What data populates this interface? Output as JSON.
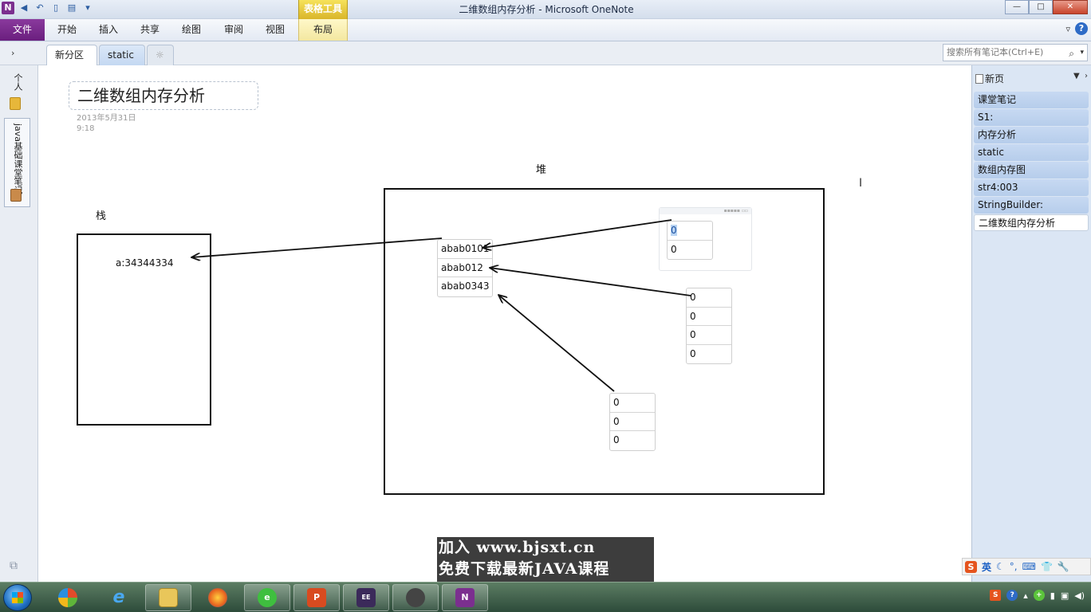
{
  "app": {
    "window_title": "二维数组内存分析 - Microsoft OneNote",
    "contextual_group": "表格工具",
    "win_buttons": {
      "minimize": "—",
      "maximize": "□",
      "close": "✕"
    }
  },
  "ribbon": {
    "file": "文件",
    "tabs": [
      "开始",
      "插入",
      "共享",
      "绘图",
      "审阅",
      "视图"
    ],
    "layout_tab": "布局"
  },
  "section_tabs": {
    "active": "新分区 1",
    "second": "static",
    "add": "☼"
  },
  "search": {
    "placeholder": "搜索所有笔记本(Ctrl+E)",
    "icon": "search-icon"
  },
  "notebooks": {
    "collapsed_label": "个人",
    "java_label": "java基础课堂笔记"
  },
  "page": {
    "title": "二维数组内存分析",
    "date": "2013年5月31日",
    "time": "9:18",
    "heap_label": "堆",
    "stack_label": "栈",
    "stack_var": "a:34344334",
    "outer_array": [
      "abab0101",
      "abab012",
      "abab0343"
    ],
    "array1": [
      "0",
      "0"
    ],
    "array2": [
      "0",
      "0",
      "0",
      "0"
    ],
    "array3": [
      "0",
      "0",
      "0"
    ]
  },
  "pages_panel": {
    "new_page": "新页",
    "items": [
      "课堂笔记",
      "S1:",
      "内存分析",
      "static",
      "数组内存图",
      "str4:003",
      "StringBuilder:",
      "二维数组内存分析"
    ],
    "active_index": 7
  },
  "watermark": {
    "line1": "加入 www.bjsxt.cn",
    "line2": "免费下载最新JAVA课程"
  },
  "ime": {
    "mode": "英"
  },
  "taskbar": {
    "apps": [
      "explorer",
      "ie",
      "folder",
      "firefox",
      "360",
      "powerpoint",
      "javaee-ide",
      "tool",
      "onenote"
    ]
  }
}
